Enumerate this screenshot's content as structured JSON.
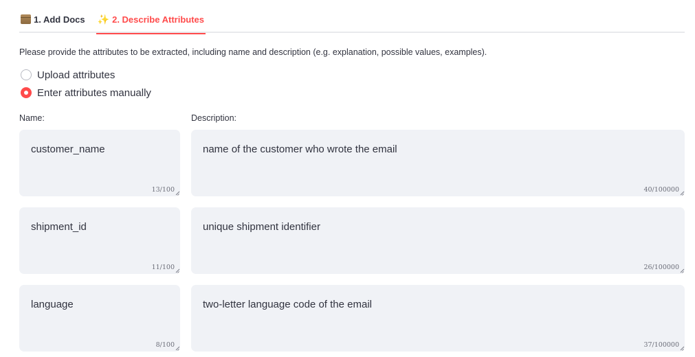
{
  "tabs": [
    {
      "label": "1. Add Docs",
      "icon": "box-icon",
      "active": false
    },
    {
      "label": "2. Describe Attributes",
      "icon": "sparkles-icon",
      "active": true
    }
  ],
  "intro_text": "Please provide the attributes to be extracted, including name and description (e.g. explanation, possible values, examples).",
  "input_mode": {
    "options": [
      "Upload attributes",
      "Enter attributes manually"
    ],
    "selected": "Enter attributes manually"
  },
  "columns": {
    "name_label": "Name:",
    "description_label": "Description:"
  },
  "attributes": [
    {
      "name": "customer_name",
      "name_count": "13/100",
      "description": "name of the customer who wrote the email",
      "description_count": "40/100000"
    },
    {
      "name": "shipment_id",
      "name_count": "11/100",
      "description": "unique shipment identifier",
      "description_count": "26/100000"
    },
    {
      "name": "language",
      "name_count": "8/100",
      "description": "two-letter language code of the email",
      "description_count": "37/100000"
    }
  ],
  "colors": {
    "accent": "#ff4b4b",
    "field_bg": "#f0f2f6"
  }
}
